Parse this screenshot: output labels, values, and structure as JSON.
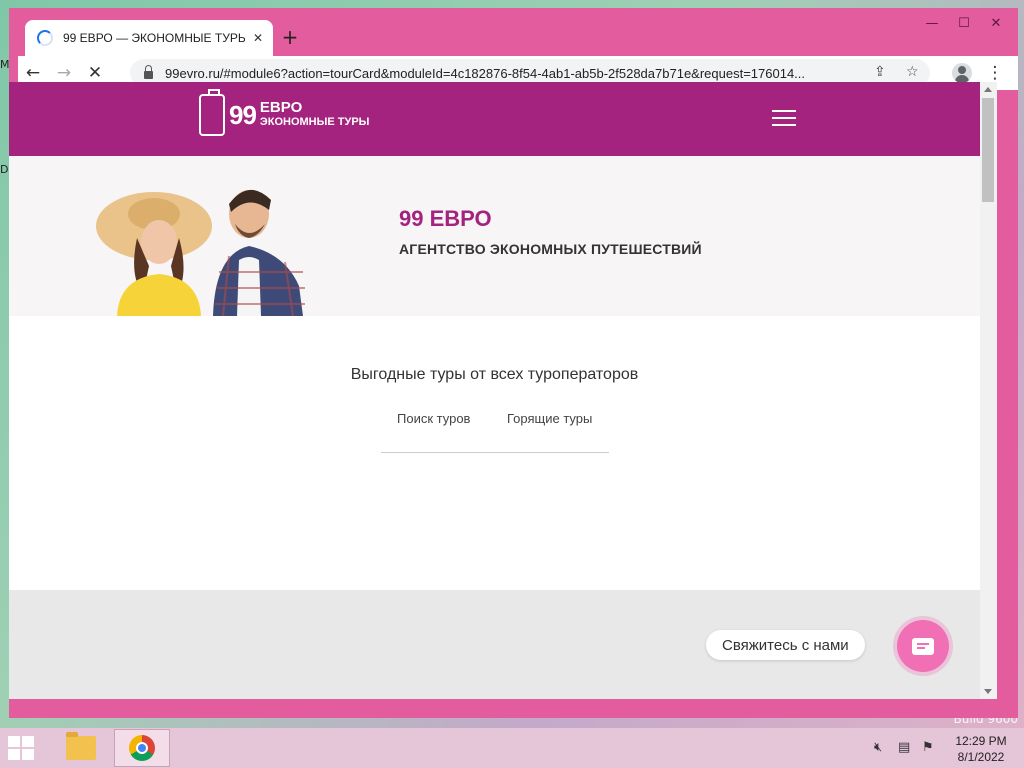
{
  "desktop": {
    "edge_fragment_1": "M",
    "edge_fragment_2": "D",
    "watermark_1": "o",
    "watermark_2": "Build 9600"
  },
  "window_controls": {
    "minimize": "—",
    "maximize": "☐",
    "close": "✕"
  },
  "browser": {
    "tab_title": "99 ЕВРО — ЭКОНОМНЫЕ ТУРЫ",
    "tab_close": "✕",
    "new_tab": "+",
    "url": "99evro.ru/#module6?action=tourCard&moduleId=4c182876-8f54-4ab1-ab5b-2f528da7b71e&request=176014...",
    "back": "←",
    "forward": "→",
    "stop": "✕",
    "share": "⇪",
    "star": "☆",
    "menu": "⋮"
  },
  "site": {
    "logo_number": "99",
    "logo_line1": "ЕВРО",
    "logo_line2": "ЭКОНОМНЫЕ ТУРЫ",
    "logo_small": "EBPO",
    "hero_title": "99 ЕВРО",
    "hero_subtitle": "АГЕНТСТВО ЭКОНОМНЫХ ПУТЕШЕСТВИЙ",
    "search_heading": "Выгодные туры от всех туроператоров",
    "search_tabs": [
      "Поиск туров",
      "Горящие туры"
    ],
    "contact_label": "Свяжитесь с нами"
  },
  "colors": {
    "brand": "#a4237f",
    "contact": "#f06fb5",
    "window_frame": "#e35c9d"
  },
  "taskbar": {
    "time": "12:29 PM",
    "date": "8/1/2022",
    "tray_icons": [
      "volume-muted-icon",
      "network-icon",
      "action-center-icon"
    ]
  }
}
